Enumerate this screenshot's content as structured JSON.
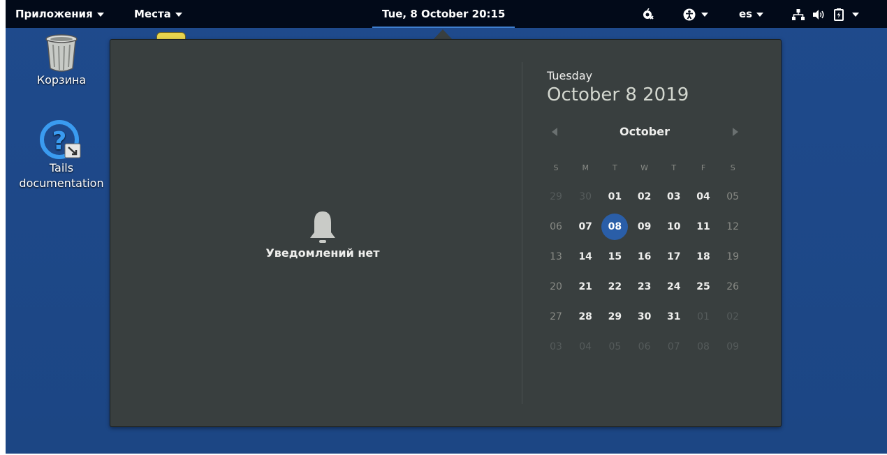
{
  "topbar": {
    "applications_label": "Приложения",
    "places_label": "Места",
    "clock": "Tue, 8 October  20:15",
    "keyboard_layout": "es",
    "icons": [
      "tor-onion-icon",
      "accessibility-icon",
      "network-icon",
      "volume-icon",
      "battery-icon"
    ]
  },
  "desktop": {
    "trash_label": "Корзина",
    "docs_label_line1": "Tails",
    "docs_label_line2": "documentation"
  },
  "notifications": {
    "empty_text": "Уведомлений нет"
  },
  "calendar": {
    "weekday": "Tuesday",
    "full_date": "October  8 2019",
    "month": "October",
    "day_names": [
      "S",
      "M",
      "T",
      "W",
      "T",
      "F",
      "S"
    ],
    "weeks": [
      [
        "29",
        "30",
        "01",
        "02",
        "03",
        "04",
        "05"
      ],
      [
        "06",
        "07",
        "08",
        "09",
        "10",
        "11",
        "12"
      ],
      [
        "13",
        "14",
        "15",
        "16",
        "17",
        "18",
        "19"
      ],
      [
        "20",
        "21",
        "22",
        "23",
        "24",
        "25",
        "26"
      ],
      [
        "27",
        "28",
        "29",
        "30",
        "31",
        "01",
        "02"
      ],
      [
        "03",
        "04",
        "05",
        "06",
        "07",
        "08",
        "09"
      ]
    ],
    "today": "08",
    "accent_color": "#2a5ea8"
  }
}
